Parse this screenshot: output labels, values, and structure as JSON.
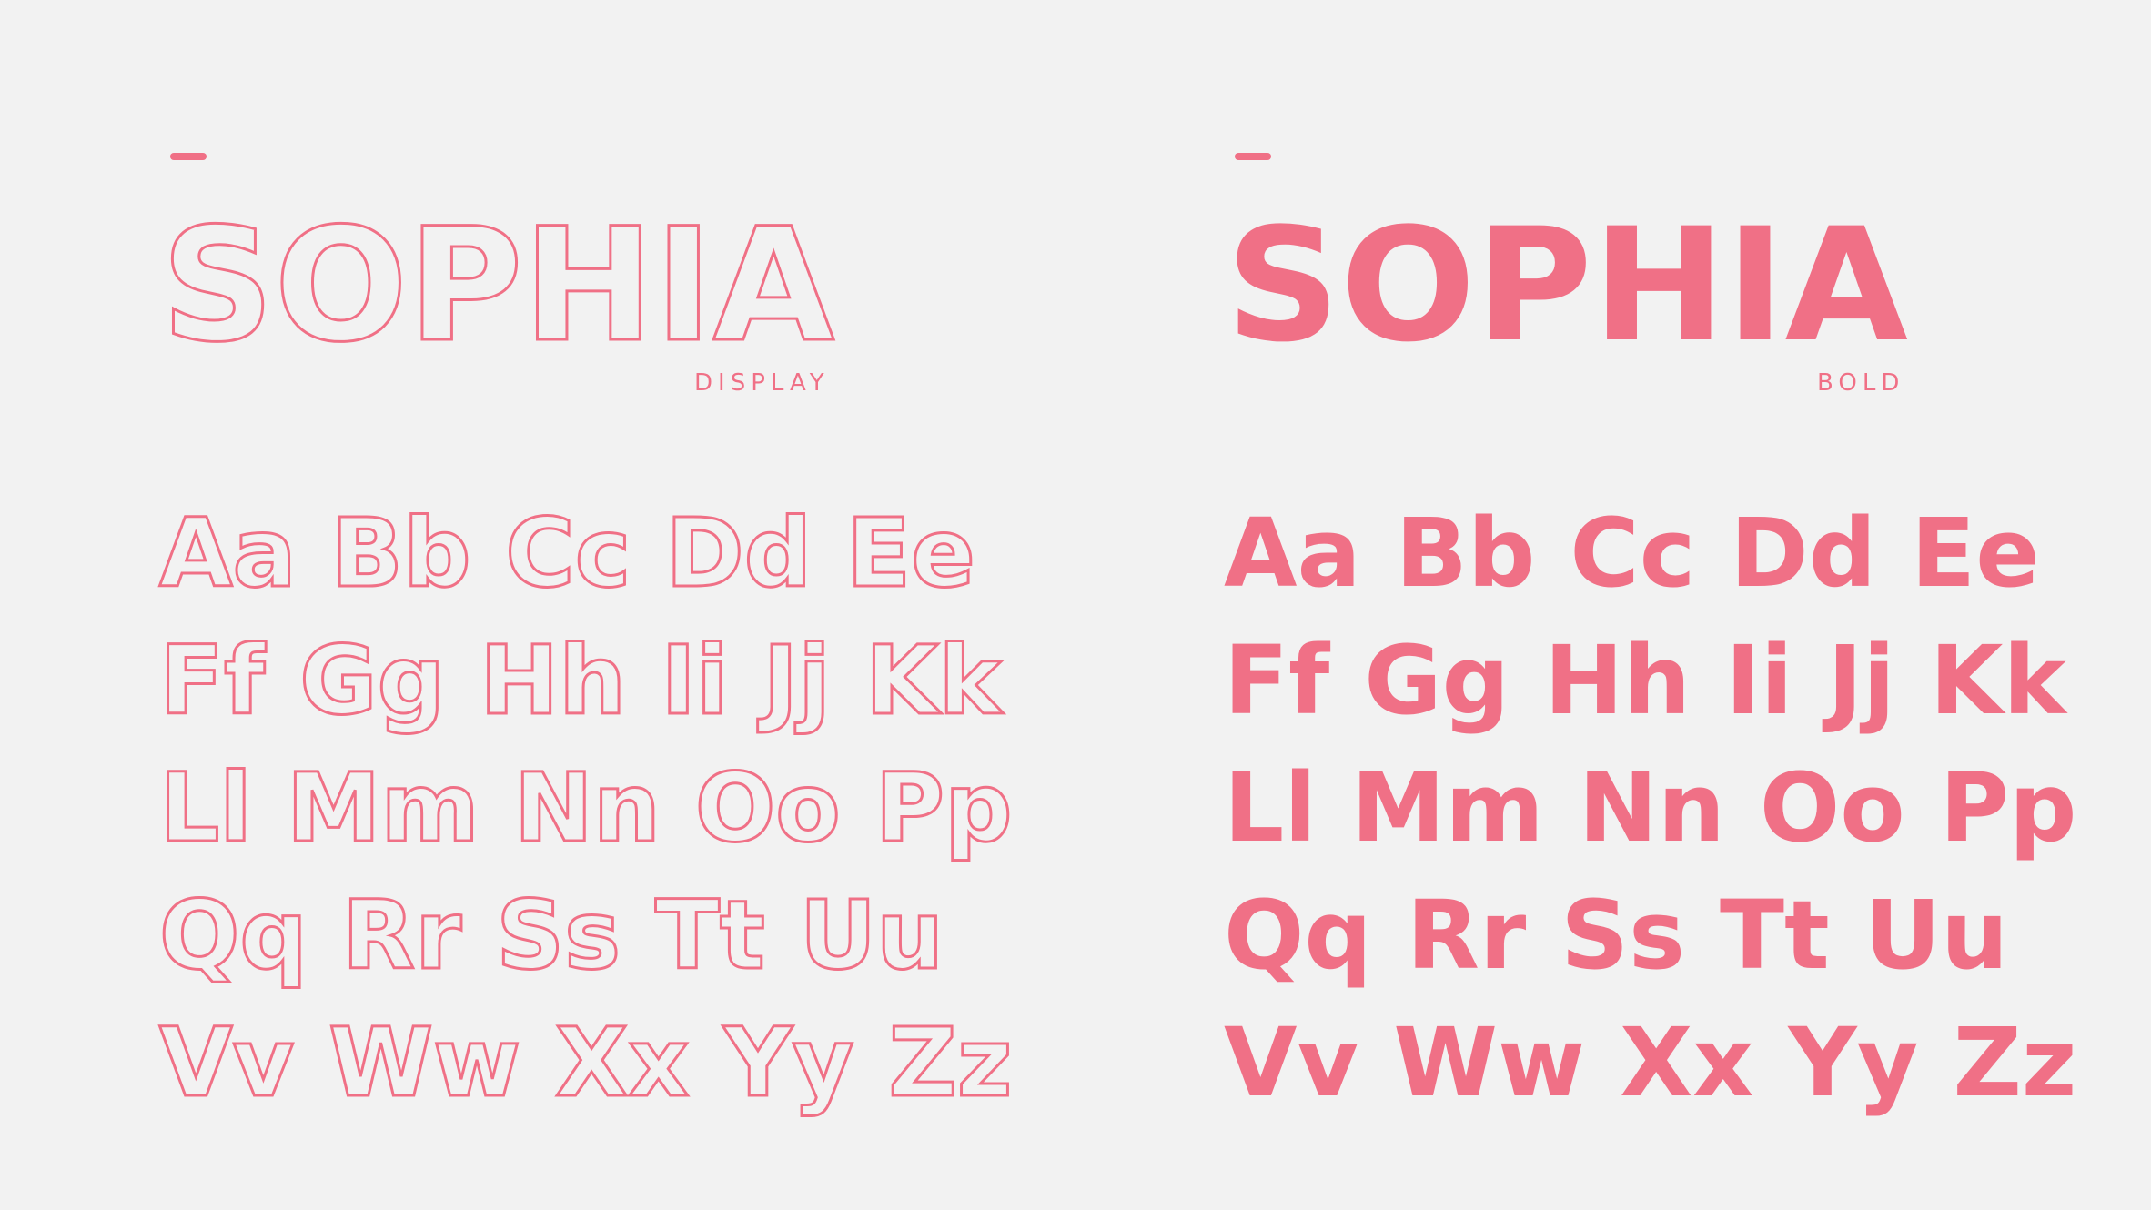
{
  "accent_color": "#f07086",
  "background_color": "#f2f2f2",
  "display_panel": {
    "title": "SOPHIA",
    "subtitle": "DISPLAY",
    "alphabet": [
      [
        "Aa",
        "Bb",
        "Cc",
        "Dd",
        "Ee"
      ],
      [
        "Ff",
        "Gg",
        "Hh",
        "Ii",
        "Jj",
        "Kk"
      ],
      [
        "Ll",
        "Mm",
        "Nn",
        "Oo",
        "Pp"
      ],
      [
        "Qq",
        "Rr",
        "Ss",
        "Tt",
        "Uu"
      ],
      [
        "Vv",
        "Ww",
        "Xx",
        "Yy",
        "Zz"
      ]
    ]
  },
  "bold_panel": {
    "title": "SOPHIA",
    "subtitle": "BOLD",
    "alphabet": [
      [
        "Aa",
        "Bb",
        "Cc",
        "Dd",
        "Ee"
      ],
      [
        "Ff",
        "Gg",
        "Hh",
        "Ii",
        "Jj",
        "Kk"
      ],
      [
        "Ll",
        "Mm",
        "Nn",
        "Oo",
        "Pp"
      ],
      [
        "Qq",
        "Rr",
        "Ss",
        "Tt",
        "Uu"
      ],
      [
        "Vv",
        "Ww",
        "Xx",
        "Yy",
        "Zz"
      ]
    ]
  }
}
